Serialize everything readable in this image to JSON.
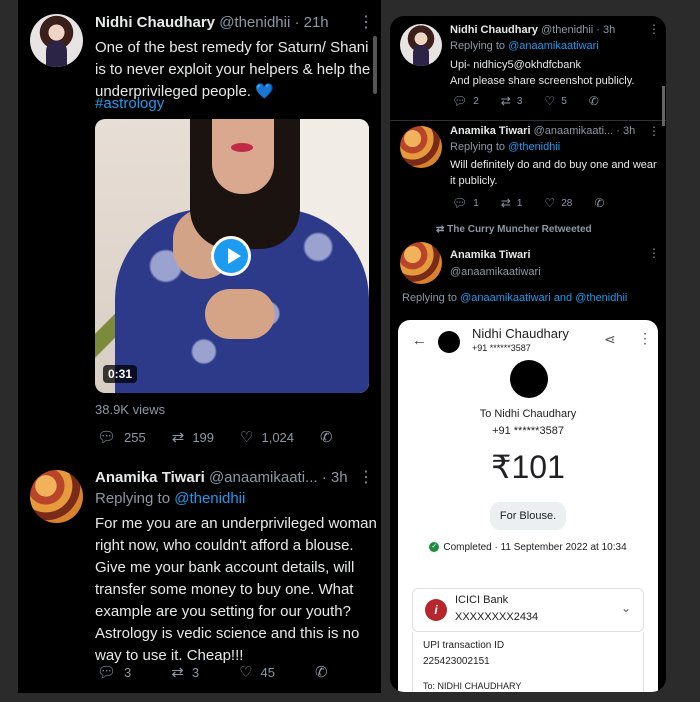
{
  "left": {
    "tweet1": {
      "name": "Nidhi Chaudhary",
      "handle": "@thenidhii · 21h",
      "text": "One of the best remedy for Saturn/ Shani is to never exploit your helpers & help the underprivileged people.",
      "heart": "💙",
      "hashtag": "#astrology",
      "video_duration": "0:31",
      "views": "38.9K views",
      "replies": "255",
      "retweets": "199",
      "likes": "1,024"
    },
    "tweet2": {
      "name": "Anamika Tiwari",
      "handle": "@anaamikaati... · 3h",
      "replying_label": "Replying to",
      "replying_to": "@thenidhii",
      "text": "For me you are an underprivileged woman right now, who couldn't afford a blouse. Give me your bank account details, will transfer some money to buy one. What example are you setting for our youth? Astrology is vedic science and this is no way to use it. Cheap!!!",
      "replies": "3",
      "retweets": "3",
      "likes": "45"
    }
  },
  "right": {
    "tweet1": {
      "name": "Nidhi Chaudhary",
      "handle": "@thenidhii · 3h",
      "replying_label": "Replying to",
      "replying_to": "@anaamikaatiwari",
      "line1": "Upi- nidhicy5@okhdfcbank",
      "line2": "And please share screenshot publicly.",
      "replies": "2",
      "retweets": "3",
      "likes": "5"
    },
    "tweet2": {
      "name": "Anamika Tiwari",
      "handle": "@anaamikaati... · 3h",
      "replying_label": "Replying to",
      "replying_to": "@thenidhii",
      "text": "Will definitely do and do buy one and wear it publicly.",
      "replies": "1",
      "retweets": "1",
      "likes": "28"
    },
    "retweeted_label": "The Curry Muncher Retweeted",
    "tweet3": {
      "name": "Anamika Tiwari",
      "handle": "@anaamikaatiwari",
      "replying_label": "Replying to",
      "replying_to": "@anaamikaatiwari and @thenidhii"
    },
    "payment": {
      "top_name": "Nidhi Chaudhary",
      "top_phone": "+91 ******3587",
      "to_label": "To Nidhi Chaudhary",
      "phone": "+91 ******3587",
      "amount": "₹101",
      "note": "For Blouse.",
      "status": "Completed · 11 September 2022 at 10:34",
      "bank_name": "ICICI Bank",
      "bank_account": "XXXXXXXX2434",
      "txn_label": "UPI transaction ID",
      "txn_id": "225423002151",
      "to_name": "To: NIDHI CHAUDHARY"
    }
  },
  "colors": {
    "accent": "#1d9bf0",
    "bg": "#000000",
    "muted": "#8b98a5",
    "success": "#1e8e3e"
  }
}
